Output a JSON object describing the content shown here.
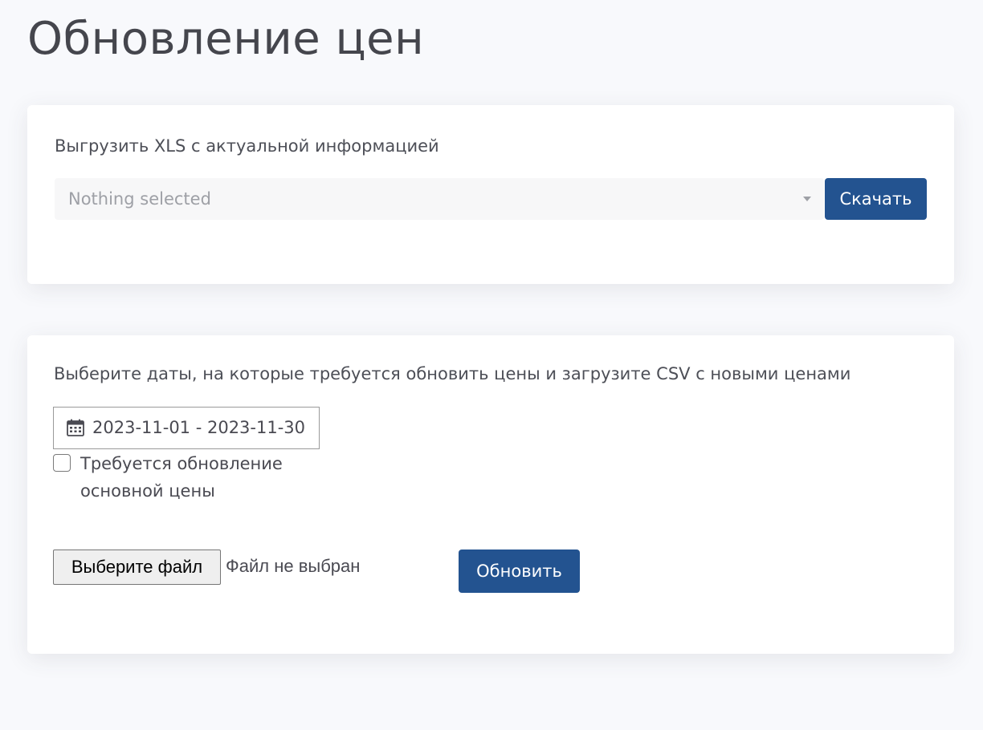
{
  "page": {
    "title": "Обновление цен"
  },
  "export_card": {
    "label": "Выгрузить XLS с актуальной информацией",
    "select_value": "Nothing selected",
    "download_label": "Скачать"
  },
  "update_card": {
    "label": "Выберите даты, на которые требуется обновить цены и загрузите CSV с новыми ценами",
    "date_range": "2023-11-01 - 2023-11-30",
    "checkbox_label": "Требуется обновление основной цены",
    "checkbox_checked": false,
    "file_button_label": "Выберите файл",
    "file_status": "Файл не выбран",
    "update_label": "Обновить"
  },
  "icons": {
    "select_caret": "caret-down-icon",
    "date": "calendar-icon"
  },
  "colors": {
    "primary": "#235390",
    "background": "#f8f9fc",
    "card": "#ffffff",
    "placeholder": "#9ea0a6"
  }
}
